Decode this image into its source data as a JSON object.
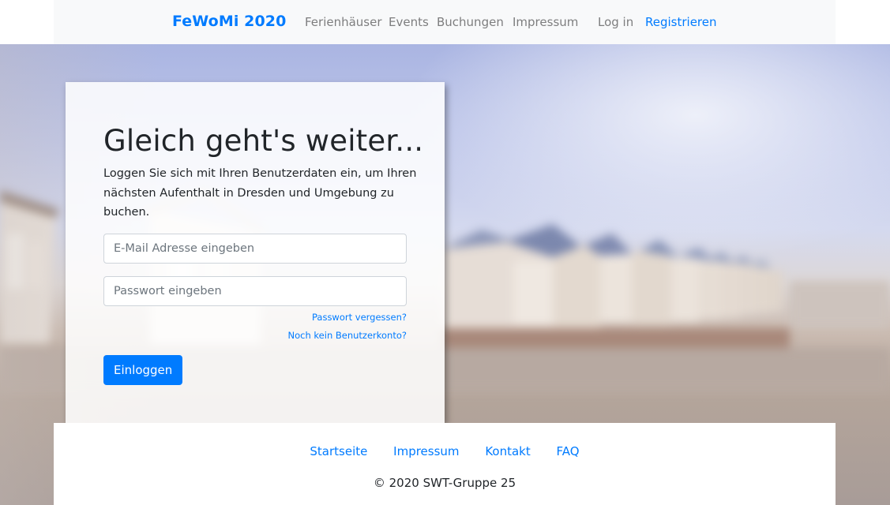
{
  "navbar": {
    "brand": "FeWoMi 2020",
    "links": [
      "Ferienhäuser",
      "Events",
      "Buchungen",
      "Impressum"
    ],
    "login": "Log in",
    "register": "Registrieren"
  },
  "login_card": {
    "title": "Gleich geht's weiter...",
    "lead": "Loggen Sie sich mit Ihren Benutzerdaten ein, um Ihren nächsten Aufenthalt in Dresden und Umgebung zu buchen.",
    "email_placeholder": "E-Mail Adresse eingeben",
    "email_value": "",
    "password_placeholder": "Passwort eingeben",
    "password_value": "",
    "forgot_password": "Passwort vergessen?",
    "no_account": "Noch kein Benutzerkonto?",
    "submit": "Einloggen"
  },
  "footer": {
    "links": [
      "Startseite",
      "Impressum",
      "Kontakt",
      "FAQ"
    ],
    "copyright": "© 2020 SWT-Gruppe 25"
  },
  "colors": {
    "accent": "#007bff",
    "navbar_bg": "#f8f9fa",
    "text": "#212529",
    "nav_muted": "rgba(0,0,0,0.5)"
  }
}
